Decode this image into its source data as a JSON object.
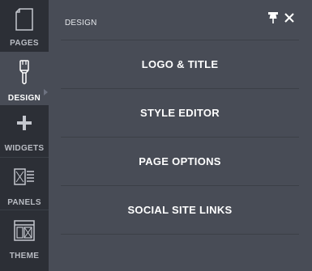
{
  "sidebar": {
    "items": [
      {
        "label": "PAGES",
        "icon": "page-icon"
      },
      {
        "label": "DESIGN",
        "icon": "paintbrush-icon",
        "active": true
      },
      {
        "label": "WIDGETS",
        "icon": "plus-icon"
      },
      {
        "label": "PANELS",
        "icon": "panel-icon"
      },
      {
        "label": "THEME",
        "icon": "theme-icon"
      }
    ]
  },
  "panel": {
    "title": "DESIGN",
    "pin_icon": "pin-icon",
    "close_icon": "close-icon",
    "items": [
      {
        "label": "LOGO & TITLE"
      },
      {
        "label": "STYLE EDITOR"
      },
      {
        "label": "PAGE OPTIONS"
      },
      {
        "label": "SOCIAL SITE LINKS"
      }
    ]
  },
  "colors": {
    "rail_bg": "#2c2f36",
    "panel_bg": "#484c56",
    "text": "#ffffff",
    "rail_text": "#b9bcc3"
  }
}
